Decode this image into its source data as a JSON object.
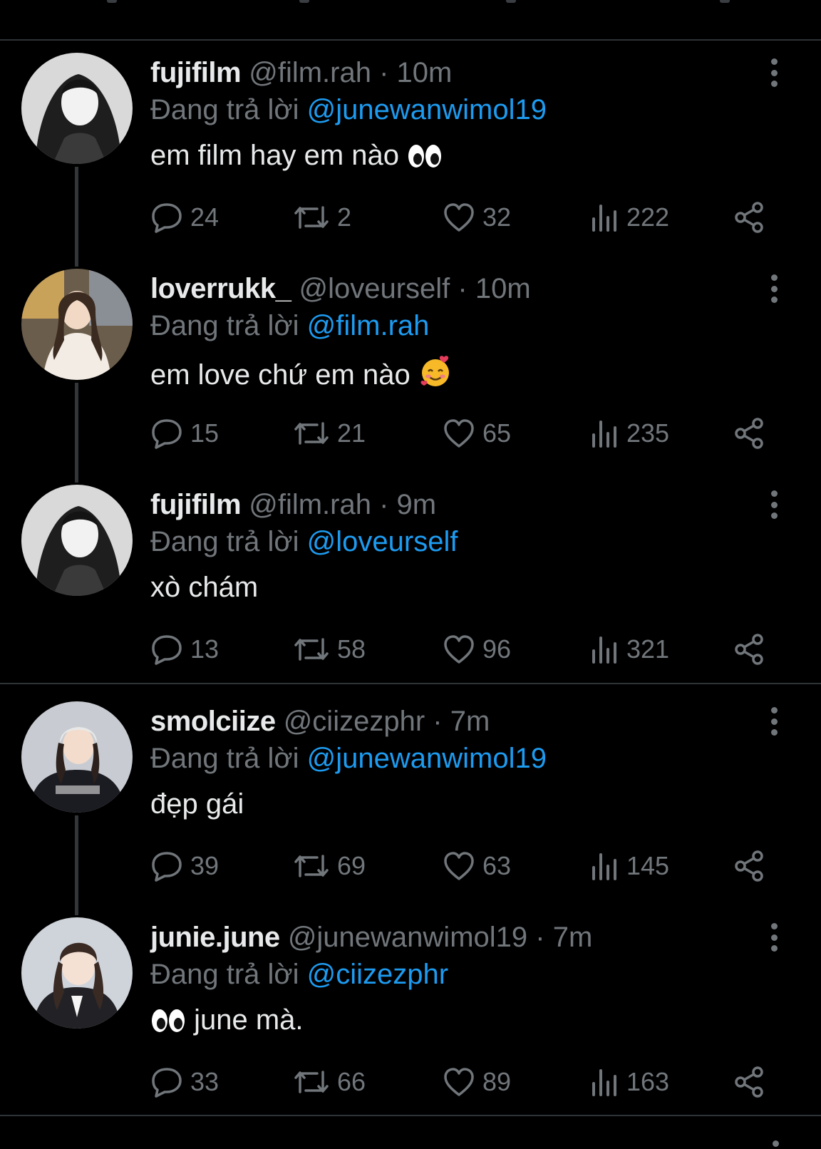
{
  "colors": {
    "background": "#000000",
    "text": "#e7e9ea",
    "muted": "#71767b",
    "mention": "#1d9bf0",
    "divider": "#2f3336"
  },
  "reply_prefix": "Đang trả lời",
  "tweets": [
    {
      "display_name": "fujifilm",
      "handle": "@film.rah",
      "separator": "·",
      "time": "10m",
      "reply_to": "@junewanwimol19",
      "text": "em film hay em nào",
      "emoji": "eyes",
      "replies": "24",
      "retweets": "2",
      "likes": "32",
      "views": "222"
    },
    {
      "display_name": "loverrukk_",
      "handle": "@loveurself",
      "separator": "·",
      "time": "10m",
      "reply_to": "@film.rah",
      "text": "em love chứ em nào",
      "emoji": "smiling-face-with-hearts",
      "replies": "15",
      "retweets": "21",
      "likes": "65",
      "views": "235"
    },
    {
      "display_name": "fujifilm",
      "handle": "@film.rah",
      "separator": "·",
      "time": "9m",
      "reply_to": "@loveurself",
      "text": "xò chám",
      "emoji": "",
      "replies": "13",
      "retweets": "58",
      "likes": "96",
      "views": "321"
    },
    {
      "display_name": "smolciize",
      "handle": "@ciizezphr",
      "separator": "·",
      "time": "7m",
      "reply_to": "@junewanwimol19",
      "text": "đẹp gái",
      "emoji": "",
      "replies": "39",
      "retweets": "69",
      "likes": "63",
      "views": "145"
    },
    {
      "display_name": "junie.june",
      "handle": "@junewanwimol19",
      "separator": "·",
      "time": "7m",
      "reply_to": "@ciizezphr",
      "text": "june mà.",
      "emoji": "eyes",
      "replies": "33",
      "retweets": "66",
      "likes": "89",
      "views": "163"
    }
  ]
}
